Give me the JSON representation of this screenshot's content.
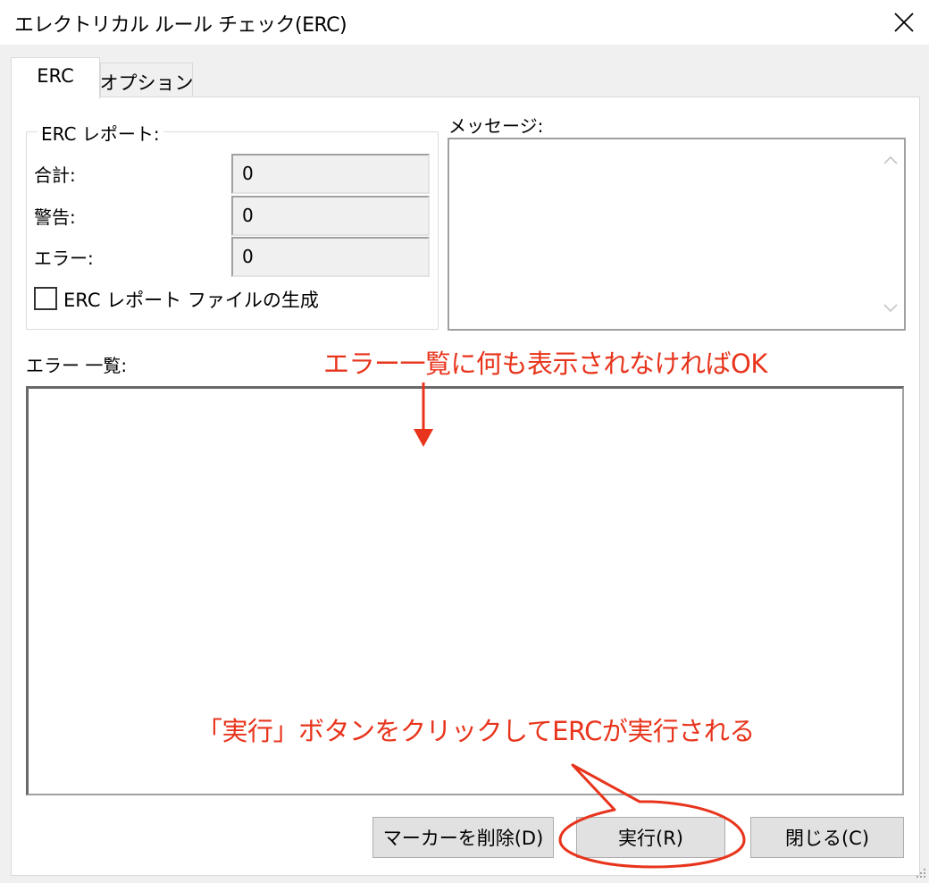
{
  "window": {
    "title": "エレクトリカル ルール チェック(ERC)",
    "close_label": "✕"
  },
  "tabs": [
    {
      "label": "ERC",
      "active": true
    },
    {
      "label": "オプション",
      "active": false
    }
  ],
  "erc_report": {
    "group_label": "ERC レポート:",
    "fields": [
      {
        "label": "合計:",
        "value": "0"
      },
      {
        "label": "警告:",
        "value": "0"
      },
      {
        "label": "エラー:",
        "value": "0"
      }
    ],
    "checkbox_label": "ERC レポート ファイルの生成",
    "checkbox_checked": false
  },
  "messages": {
    "label": "メッセージ:"
  },
  "error_list": {
    "label": "エラー 一覧:"
  },
  "buttons": {
    "delete_markers": "マーカーを削除(D)",
    "run": "実行(R)",
    "close": "閉じる(C)"
  },
  "annotations": {
    "error_list_note": "エラー一覧に何も表示されなければOK",
    "run_note": "「実行」ボタンをクリックしてERCが実行される",
    "color": "#e8341c"
  }
}
